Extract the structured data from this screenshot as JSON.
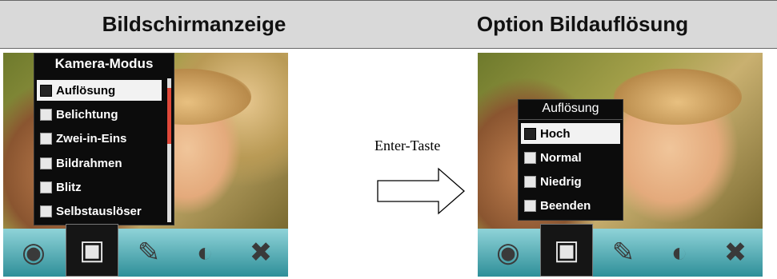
{
  "headers": {
    "left": "Bildschirmanzeige",
    "right": "Option Bildauflösung"
  },
  "left_menu": {
    "title": "Kamera-Modus",
    "items": [
      {
        "label": "Auflösung",
        "icon": "resolution-icon",
        "selected": true
      },
      {
        "label": "Belichtung",
        "icon": "exposure-icon",
        "selected": false
      },
      {
        "label": "Zwei-in-Eins",
        "icon": "two-in-one-icon",
        "selected": false
      },
      {
        "label": "Bildrahmen",
        "icon": "frame-icon",
        "selected": false
      },
      {
        "label": "Blitz",
        "icon": "flash-icon",
        "selected": false
      },
      {
        "label": "Selbstauslöser",
        "icon": "self-timer-icon",
        "selected": false
      }
    ]
  },
  "right_menu": {
    "title": "Auflösung",
    "items": [
      {
        "label": "Hoch",
        "icon": "high-res-icon",
        "selected": true
      },
      {
        "label": "Normal",
        "icon": "normal-res-icon",
        "selected": false
      },
      {
        "label": "Niedrig",
        "icon": "low-res-icon",
        "selected": false
      },
      {
        "label": "Beenden",
        "icon": "exit-icon",
        "selected": false
      }
    ]
  },
  "transition": {
    "label": "Enter-Taste"
  },
  "mode_bar": {
    "icons": [
      "film-reel-icon",
      "camera-icon",
      "microphone-icon",
      "palette-icon",
      "tools-icon"
    ],
    "selected": "camera-icon"
  },
  "colors": {
    "header_bg": "#d9d9d9",
    "menu_bg": "#0c0c0c",
    "selected_item_bg": "#f2f2f2",
    "mode_bar": "#3aa0a8",
    "scroll_thumb": "#e0483a"
  }
}
